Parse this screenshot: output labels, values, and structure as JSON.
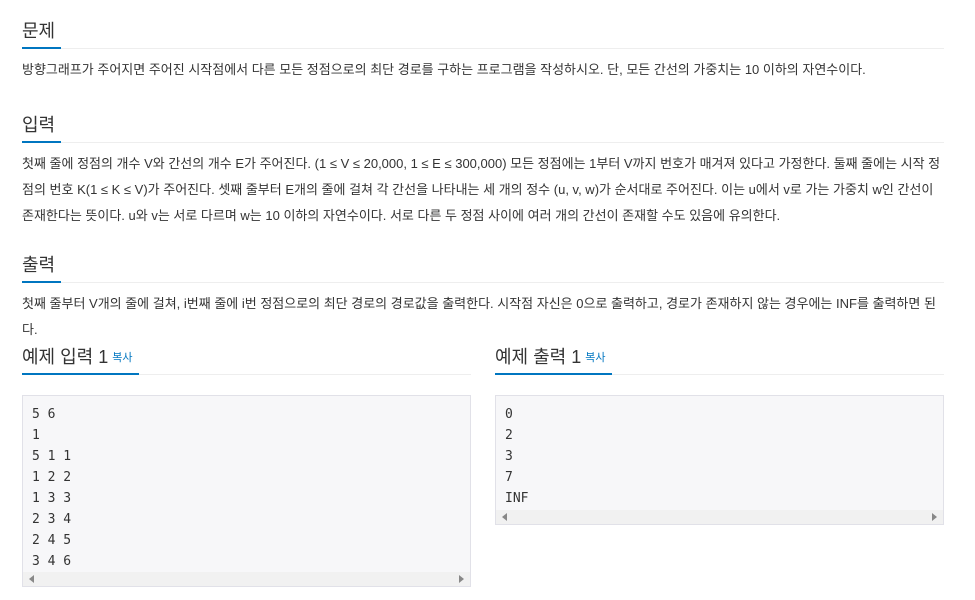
{
  "problem": {
    "title": "문제",
    "text": "방향그래프가 주어지면 주어진 시작점에서 다른 모든 정점으로의 최단 경로를 구하는 프로그램을 작성하시오. 단, 모든 간선의 가중치는 10 이하의 자연수이다."
  },
  "input": {
    "title": "입력",
    "text": "첫째 줄에 정점의 개수 V와 간선의 개수 E가 주어진다. (1 ≤ V ≤ 20,000, 1 ≤ E ≤ 300,000) 모든 정점에는 1부터 V까지 번호가 매겨져 있다고 가정한다. 둘째 줄에는 시작 정점의 번호 K(1 ≤ K ≤ V)가 주어진다. 셋째 줄부터 E개의 줄에 걸쳐 각 간선을 나타내는 세 개의 정수 (u, v, w)가 순서대로 주어진다. 이는 u에서 v로 가는 가중치 w인 간선이 존재한다는 뜻이다. u와 v는 서로 다르며 w는 10 이하의 자연수이다. 서로 다른 두 정점 사이에 여러 개의 간선이 존재할 수도 있음에 유의한다."
  },
  "output": {
    "title": "출력",
    "text": "첫째 줄부터 V개의 줄에 걸쳐, i번째 줄에 i번 정점으로의 최단 경로의 경로값을 출력한다. 시작점 자신은 0으로 출력하고, 경로가 존재하지 않는 경우에는 INF를 출력하면 된다."
  },
  "sample_input": {
    "title": "예제 입력 1",
    "copy": "복사",
    "text": "5 6\n1\n5 1 1\n1 2 2\n1 3 3\n2 3 4\n2 4 5\n3 4 6"
  },
  "sample_output": {
    "title": "예제 출력 1",
    "copy": "복사",
    "text": "0\n2\n3\n7\nINF"
  }
}
